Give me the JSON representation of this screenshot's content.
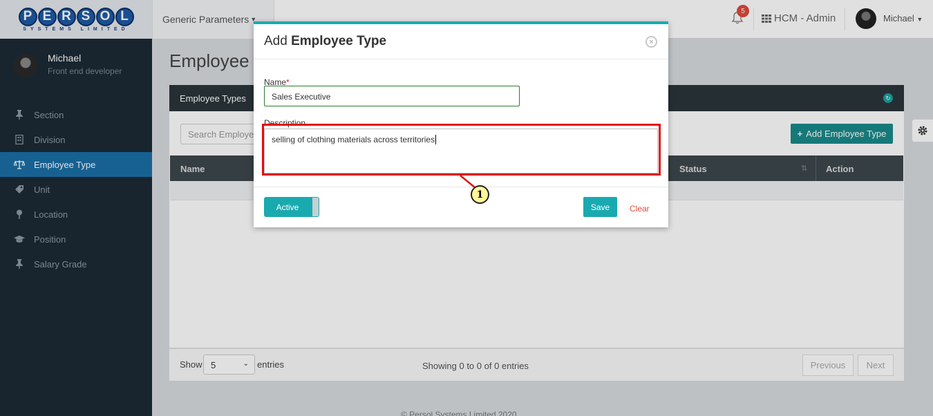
{
  "logo": {
    "letters": [
      "P",
      "E",
      "R",
      "S",
      "O",
      "L"
    ],
    "tagline": "SYSTEMS LIMITED"
  },
  "topnav": {
    "module_label": "Generic Parameters",
    "notifications_count": "5",
    "app_label": "HCM - Admin",
    "user_name": "Michael"
  },
  "sidebar": {
    "user_name": "Michael",
    "user_role": "Front end developer",
    "items": [
      {
        "label": "Section",
        "icon": "pin-icon"
      },
      {
        "label": "Division",
        "icon": "building-icon"
      },
      {
        "label": "Employee Type",
        "icon": "scale-icon",
        "active": true
      },
      {
        "label": "Unit",
        "icon": "tag-icon"
      },
      {
        "label": "Location",
        "icon": "map-pin-icon"
      },
      {
        "label": "Position",
        "icon": "graduation-cap-icon"
      },
      {
        "label": "Salary Grade",
        "icon": "pin-icon"
      }
    ]
  },
  "page": {
    "title": "Employee T",
    "panel_title": "Employee Types",
    "search_placeholder": "Search Employee",
    "add_button": "Add Employee Type",
    "columns": {
      "name": "Name",
      "status": "Status",
      "action": "Action"
    },
    "show_label": "Show",
    "page_size": "5",
    "entries_label": "entries",
    "showing_text": "Showing 0 to 0 of 0 entries",
    "prev_label": "Previous",
    "next_label": "Next",
    "footer": "© Persol Systems Limited 2020"
  },
  "modal": {
    "title_prefix": "Add",
    "title_bold": "Employee Type",
    "name_label": "Name",
    "required_mark": "*",
    "name_value": "Sales Executive",
    "description_label": "Description",
    "description_value": "selling of clothing materials across territories",
    "toggle_label": "Active",
    "save_label": "Save",
    "clear_label": "Clear"
  },
  "annotation": {
    "step": "1"
  },
  "colors": {
    "accent": "#19aab0",
    "sidebar": "#1c2b36",
    "active": "#1b6fa7",
    "highlight": "#e01010"
  }
}
